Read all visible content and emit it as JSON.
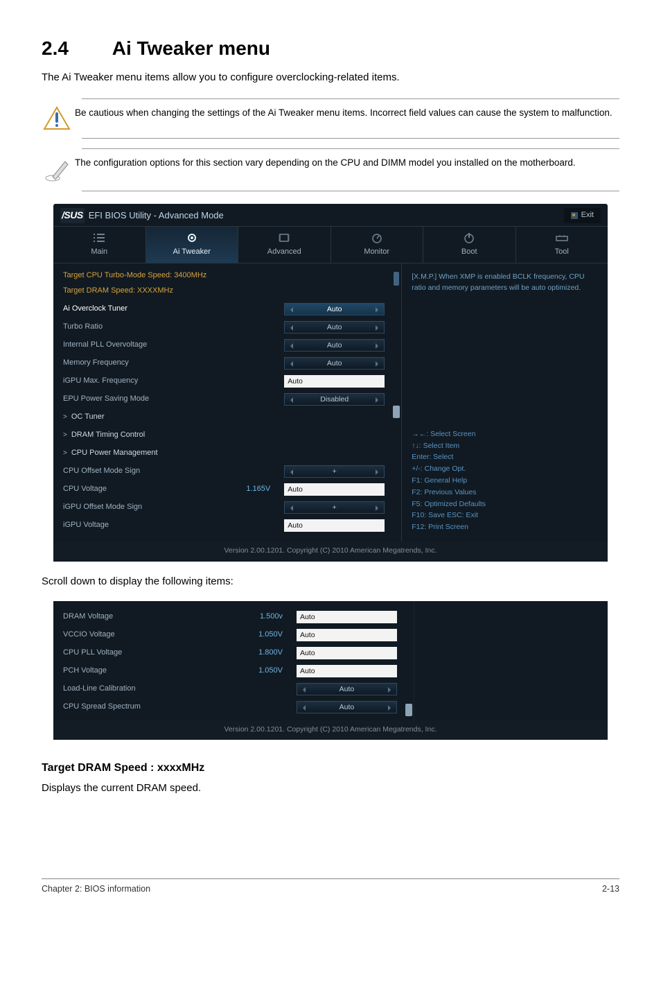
{
  "heading_num": "2.4",
  "heading_title": "Ai Tweaker menu",
  "lead": "The Ai Tweaker menu items allow you to configure overclocking-related items.",
  "warning_note": "Be cautious when changing the settings of the Ai Tweaker menu items. Incorrect field values can cause the system to malfunction.",
  "info_note": "The configuration options for this section vary depending on the CPU and DIMM model you installed on the motherboard.",
  "bios": {
    "title": "EFI BIOS Utility - Advanced Mode",
    "logo": "/SUS",
    "exit": "Exit",
    "tabs": {
      "main": "Main",
      "ai": "Ai  Tweaker",
      "advanced": "Advanced",
      "monitor": "Monitor",
      "boot": "Boot",
      "tool": "Tool"
    },
    "info1": "Target CPU Turbo-Mode Speed: 3400MHz",
    "info2": "Target DRAM Speed: XXXXMHz",
    "rows": {
      "ai_overclock": {
        "label": "Ai Overclock Tuner",
        "value": "Auto"
      },
      "turbo_ratio": {
        "label": "Turbo Ratio",
        "value": "Auto"
      },
      "internal_pll": {
        "label": "Internal PLL Overvoltage",
        "value": "Auto"
      },
      "memory_freq": {
        "label": "Memory Frequency",
        "value": "Auto"
      },
      "igpu_max": {
        "label": "iGPU Max. Frequency",
        "value": "Auto"
      },
      "epu_power": {
        "label": "EPU Power Saving Mode",
        "value": "Disabled"
      },
      "oc_tuner": {
        "label": "OC Tuner"
      },
      "dram_timing": {
        "label": "DRAM Timing Control"
      },
      "cpu_power": {
        "label": "CPU Power Management"
      },
      "cpu_offset_sign": {
        "label": "CPU Offset Mode Sign",
        "value": "+"
      },
      "cpu_voltage": {
        "label": "CPU Voltage",
        "static": "1.165V",
        "value": "Auto"
      },
      "igpu_offset_sign": {
        "label": "iGPU Offset Mode Sign",
        "value": "+"
      },
      "igpu_voltage": {
        "label": "iGPU Voltage",
        "value": "Auto"
      }
    },
    "help_text": "[X.M.P.] When XMP is enabled BCLK frequency, CPU ratio and memory parameters will be auto optimized.",
    "nav": {
      "l1": "→←:  Select Screen",
      "l2": "↑↓:  Select Item",
      "l3": "Enter:  Select",
      "l4": "+/-:  Change Opt.",
      "l5": "F1:  General Help",
      "l6": "F2:  Previous Values",
      "l7": "F5:  Optimized Defaults",
      "l8": "F10:  Save    ESC:  Exit",
      "l9": "F12: Print Screen"
    },
    "footer": "Version  2.00.1201.   Copyright  (C)  2010  American  Megatrends,  Inc."
  },
  "scroll_text": "Scroll down to display the following items:",
  "bios2": {
    "rows": {
      "dram_voltage": {
        "label": "DRAM Voltage",
        "static": "1.500v",
        "value": "Auto"
      },
      "vccio_voltage": {
        "label": "VCCIO Voltage",
        "static": "1.050V",
        "value": "Auto"
      },
      "cpu_pll_voltage": {
        "label": "CPU PLL Voltage",
        "static": "1.800V",
        "value": "Auto"
      },
      "pch_voltage": {
        "label": "PCH Voltage",
        "static": "1.050V",
        "value": "Auto"
      },
      "load_line": {
        "label": "Load-Line Calibration",
        "value": "Auto"
      },
      "cpu_spread": {
        "label": "CPU Spread Spectrum",
        "value": "Auto"
      }
    },
    "footer": "Version  2.00.1201.   Copyright  (C)  2010  American  Megatrends,  Inc."
  },
  "section": {
    "title": "Target DRAM Speed : xxxxMHz",
    "body": "Displays the current DRAM speed."
  },
  "footer": {
    "left": "Chapter 2: BIOS information",
    "right": "2-13"
  }
}
